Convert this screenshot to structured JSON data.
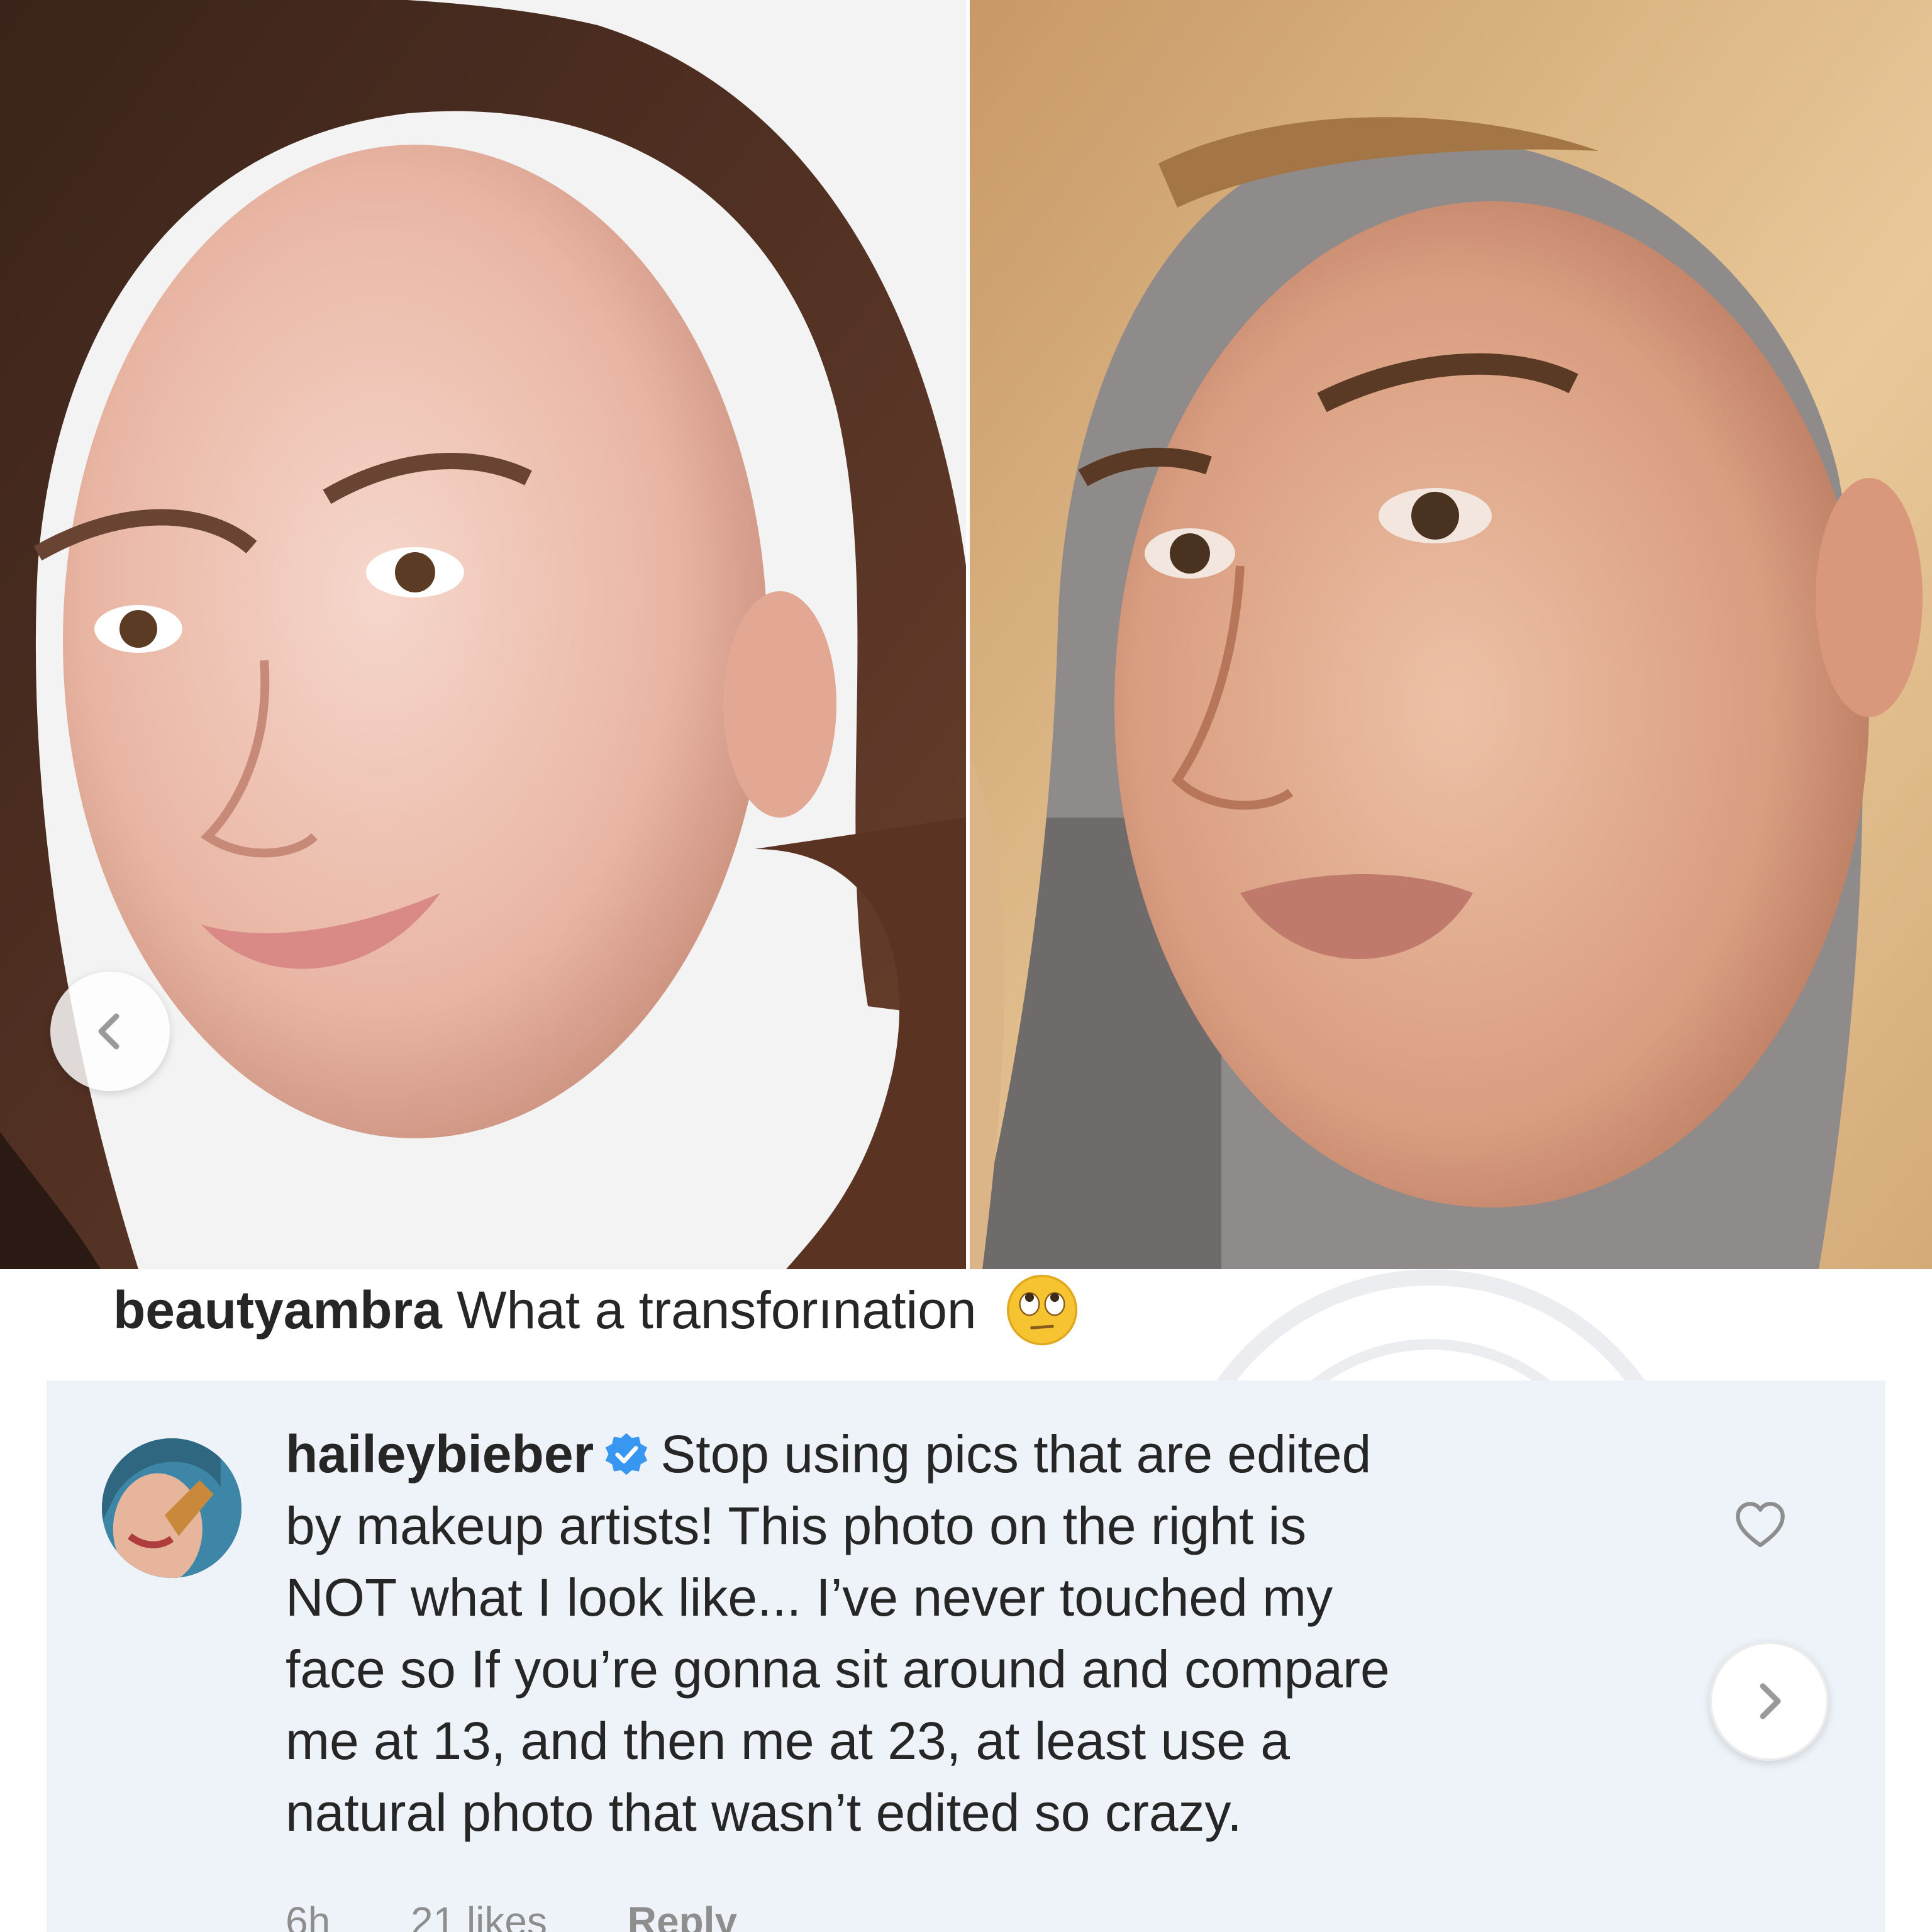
{
  "caption": {
    "username": "beautyambra",
    "text": "What a transforınation",
    "emoji": "face-with-rolling-eyes-emoji"
  },
  "reply": {
    "username": "haileybieber",
    "verified_icon": "verified-badge-icon",
    "lines": [
      "Stop using pics that are edited",
      "by makeup artists! This photo on the right is",
      "NOT what I look like... I’ve never touched my",
      "face so If you’re gonna sit around and compare",
      "me at 13, and then me at 23, at least use a",
      "natural photo that wasn’t edited so crazy."
    ],
    "time": "6h",
    "likes": "21 likes",
    "reply_label": "Reply",
    "like_icon": "heart-outline-icon"
  },
  "navigation": {
    "prev_icon": "chevron-left-icon",
    "next_icon": "chevron-right-icon"
  },
  "colors": {
    "text": "#262626",
    "meta_text": "#8e8e8e",
    "verified_blue": "#3897f0",
    "reply_panel_bg": "#eef3fa"
  }
}
